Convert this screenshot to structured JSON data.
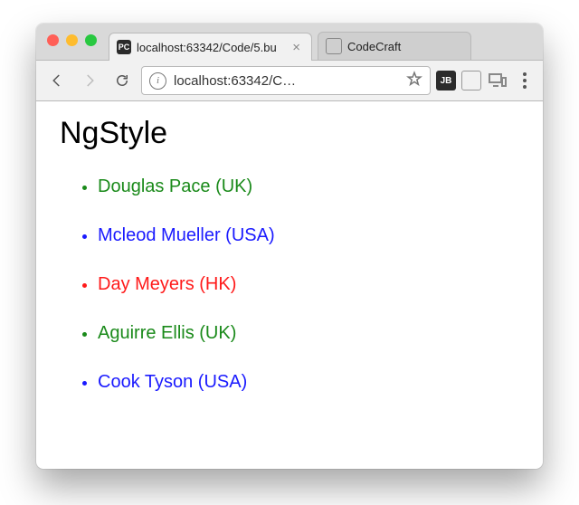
{
  "tabs": {
    "active": {
      "favicon_text": "PC",
      "label": "localhost:63342/Code/5.bu"
    },
    "inactive": {
      "label": "CodeCraft"
    }
  },
  "toolbar": {
    "url_display": "localhost:63342/C…",
    "info_glyph": "i"
  },
  "extensions": {
    "jb_badge": "JB"
  },
  "page": {
    "heading": "NgStyle",
    "people": [
      {
        "text": "Douglas Pace (UK)",
        "color": "#1a8a1a"
      },
      {
        "text": "Mcleod Mueller (USA)",
        "color": "#1a1aff"
      },
      {
        "text": "Day Meyers (HK)",
        "color": "#ff1a1a"
      },
      {
        "text": "Aguirre Ellis (UK)",
        "color": "#1a8a1a"
      },
      {
        "text": "Cook Tyson (USA)",
        "color": "#1a1aff"
      }
    ]
  }
}
